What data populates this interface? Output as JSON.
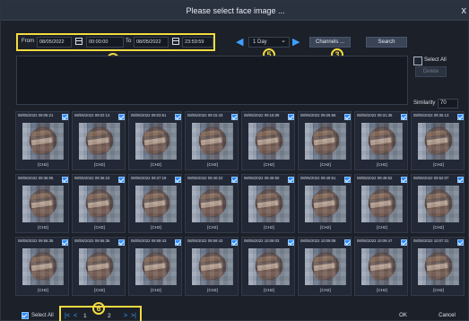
{
  "dialog": {
    "title": "Please select face image ...",
    "close_label": "x"
  },
  "search": {
    "from_label": "From",
    "from_date": "08/05/2022",
    "from_time": "00:00:00",
    "to_label": "To",
    "to_date": "08/05/2022",
    "to_time": "23:59:59",
    "range": "1 Day",
    "channels_label": "Channels ...",
    "search_label": "Search"
  },
  "markers": {
    "date_range": "4",
    "range_select": "5",
    "channels": "3",
    "pager": "6"
  },
  "side_panel": {
    "select_all_label": "Select All",
    "delete_label": "Delete",
    "similarity_label": "Similarity",
    "similarity_value": "70"
  },
  "thumbnails": [
    {
      "timestamp": "08/05/2022 08:05:21",
      "channel": "[CH2]"
    },
    {
      "timestamp": "08/05/2022 09:02:13",
      "channel": "[CH2]"
    },
    {
      "timestamp": "08/05/2022 09:03:51",
      "channel": "[CH2]"
    },
    {
      "timestamp": "08/05/2022 09:15:43",
      "channel": "[CH2]"
    },
    {
      "timestamp": "08/05/2022 09:16:08",
      "channel": "[CH2]"
    },
    {
      "timestamp": "08/05/2022 09:25:56",
      "channel": "[CH2]"
    },
    {
      "timestamp": "08/05/2022 09:31:35",
      "channel": "[CH2]"
    },
    {
      "timestamp": "08/05/2022 09:35:13",
      "channel": "[CH2]"
    },
    {
      "timestamp": "08/05/2022 09:36:06",
      "channel": "[CH2]"
    },
    {
      "timestamp": "08/05/2022 09:36:23",
      "channel": "[CH2]"
    },
    {
      "timestamp": "08/05/2022 09:37:19",
      "channel": "[CH2]"
    },
    {
      "timestamp": "08/05/2022 09:40:22",
      "channel": "[CH2]"
    },
    {
      "timestamp": "08/05/2022 09:49:50",
      "channel": "[CH2]"
    },
    {
      "timestamp": "08/05/2022 09:49:51",
      "channel": "[CH2]"
    },
    {
      "timestamp": "08/05/2022 09:49:52",
      "channel": "[CH2]"
    },
    {
      "timestamp": "08/05/2022 09:52:07",
      "channel": "[CH2]"
    },
    {
      "timestamp": "08/05/2022 09:56:35",
      "channel": "[CH2]"
    },
    {
      "timestamp": "08/05/2022 09:56:36",
      "channel": "[CH2]"
    },
    {
      "timestamp": "08/05/2022 09:59:43",
      "channel": "[CH2]"
    },
    {
      "timestamp": "08/05/2022 09:59:43",
      "channel": "[CH2]"
    },
    {
      "timestamp": "08/05/2022 10:09:03",
      "channel": "[CH2]"
    },
    {
      "timestamp": "08/05/2022 10:09:08",
      "channel": "[CH2]"
    },
    {
      "timestamp": "08/05/2022 10:09:47",
      "channel": "[CH2]"
    },
    {
      "timestamp": "08/05/2022 10:07:31",
      "channel": "[CH2]"
    }
  ],
  "footer": {
    "select_all_label": "Select All",
    "first": "|<",
    "prev": "<",
    "page_current": "1",
    "page_total": "2",
    "next": ">",
    "last": ">|",
    "ok_label": "OK",
    "cancel_label": "Cancel"
  },
  "colors": {
    "accent": "#2f8bff",
    "highlight": "#f2da3f",
    "background": "#1b2029"
  }
}
